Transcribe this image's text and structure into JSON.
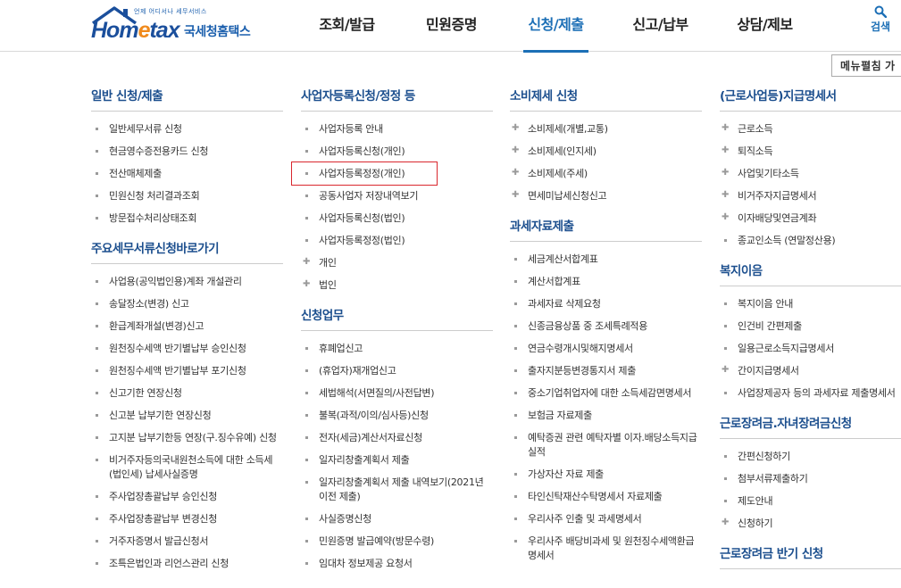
{
  "header": {
    "logo_tagline": "언제 어디서나 세무서비스",
    "logo_word_1": "Hom",
    "logo_word_2": "e",
    "logo_word_3": "tax",
    "logo_korean": "국세청홈택스",
    "nav": [
      {
        "label": "조회/발급"
      },
      {
        "label": "민원증명"
      },
      {
        "label": "신청/제출"
      },
      {
        "label": "신고/납부"
      },
      {
        "label": "상담/제보"
      }
    ],
    "search_label": "검색"
  },
  "collapse_button": "메뉴펼침 가",
  "columns": [
    {
      "sections": [
        {
          "title": "일반 신청/제출",
          "items": [
            {
              "label": "일반세무서류 신청"
            },
            {
              "label": "현금영수증전용카드 신청"
            },
            {
              "label": "전산매체제출"
            },
            {
              "label": "민원신청 처리결과조회"
            },
            {
              "label": "방문접수처리상태조회"
            }
          ]
        },
        {
          "title": "주요세무서류신청바로가기",
          "items": [
            {
              "label": "사업용(공익법인용)계좌 개설관리"
            },
            {
              "label": "송달장소(변경) 신고"
            },
            {
              "label": "환급계좌개설(변경)신고"
            },
            {
              "label": "원천징수세액 반기별납부 승인신청"
            },
            {
              "label": "원천징수세액 반기별납부 포기신청"
            },
            {
              "label": "신고기한 연장신청"
            },
            {
              "label": "신고분 납부기한 연장신청"
            },
            {
              "label": "고지분 납부기한등 연장(구.징수유예) 신청"
            },
            {
              "label": "비거주자등의국내원천소득에 대한 소득세(법인세) 납세사실증명"
            },
            {
              "label": "주사업장총괄납부 승인신청"
            },
            {
              "label": "주사업장총괄납부 변경신청"
            },
            {
              "label": "거주자증명서 발급신청서"
            },
            {
              "label": "조특은법인과 리언스관리 신청"
            }
          ]
        }
      ]
    },
    {
      "sections": [
        {
          "title": "사업자등록신청/정정 등",
          "items": [
            {
              "label": "사업자등록 안내"
            },
            {
              "label": "사업자등록신청(개인)"
            },
            {
              "label": "사업자등록정정(개인)",
              "highlight": true
            },
            {
              "label": "공동사업자 저장내역보기"
            },
            {
              "label": "사업자등록신청(법인)"
            },
            {
              "label": "사업자등록정정(법인)"
            },
            {
              "label": "개인",
              "plus": true
            },
            {
              "label": "법인",
              "plus": true
            }
          ]
        },
        {
          "title": "신청업무",
          "items": [
            {
              "label": "휴폐업신고"
            },
            {
              "label": "(휴업자)재개업신고"
            },
            {
              "label": "세법해석(서면질의/사전답변)"
            },
            {
              "label": "불복(과적/이의/심사등)신청"
            },
            {
              "label": "전자(세금)계산서자료신청"
            },
            {
              "label": "일자리창출계획서 제출"
            },
            {
              "label": "일자리창출계획서 제출 내역보기(2021년 이전 제출)"
            },
            {
              "label": "사실증명신청"
            },
            {
              "label": "민원증명 발급예약(방문수령)"
            },
            {
              "label": "임대차 정보제공 요청서"
            }
          ]
        }
      ]
    },
    {
      "sections": [
        {
          "title": "소비제세 신청",
          "items": [
            {
              "label": "소비제세(개별,교통)",
              "plus": true
            },
            {
              "label": "소비제세(인지세)",
              "plus": true
            },
            {
              "label": "소비제세(주세)",
              "plus": true
            },
            {
              "label": "면세미납세신청신고",
              "plus": true
            }
          ]
        },
        {
          "title": "과세자료제출",
          "items": [
            {
              "label": "세금계산서합계표"
            },
            {
              "label": "계산서합계표"
            },
            {
              "label": "과세자료 삭제요청"
            },
            {
              "label": "신종금융상품 중 조세특례적용"
            },
            {
              "label": "연금수령개시및해지명세서"
            },
            {
              "label": "출자지분등변경통지서 제출"
            },
            {
              "label": "중소기업취업자에 대한 소득세감면명세서"
            },
            {
              "label": "보험금 자료제출"
            },
            {
              "label": "예탁증권 관련 예탁자별 이자.배당소득지급 실적"
            },
            {
              "label": "가상자산 자료 제출"
            },
            {
              "label": "타인신탁재산수탁명세서 자료제출"
            },
            {
              "label": "우리사주 인출 및 과세명세서"
            },
            {
              "label": "우리사주 배당비과세 및 원천징수세액환급명세서"
            }
          ]
        }
      ]
    },
    {
      "sections": [
        {
          "title": "(근로사업등)지급명세서",
          "items": [
            {
              "label": "근로소득",
              "plus": true
            },
            {
              "label": "퇴직소득",
              "plus": true
            },
            {
              "label": "사업및기타소득",
              "plus": true
            },
            {
              "label": "비거주자지급명세서",
              "plus": true
            },
            {
              "label": "이자배당및연금계좌",
              "plus": true
            },
            {
              "label": "종교인소득 (연말정산용)"
            }
          ]
        },
        {
          "title": "복지이음",
          "items": [
            {
              "label": "복지이음 안내"
            },
            {
              "label": "인건비 간편제출"
            },
            {
              "label": "일용근로소득지급명세서"
            },
            {
              "label": "간이지급명세서",
              "plus": true
            },
            {
              "label": "사업장제공자 등의 과세자료 제출명세서"
            }
          ]
        },
        {
          "title": "근로장려금.자녀장려금신청",
          "items": [
            {
              "label": "간편신청하기"
            },
            {
              "label": "첨부서류제출하기"
            },
            {
              "label": "제도안내"
            },
            {
              "label": "신청하기",
              "plus": true
            }
          ]
        },
        {
          "title": "근로장려금 반기 신청",
          "items": []
        }
      ]
    }
  ]
}
